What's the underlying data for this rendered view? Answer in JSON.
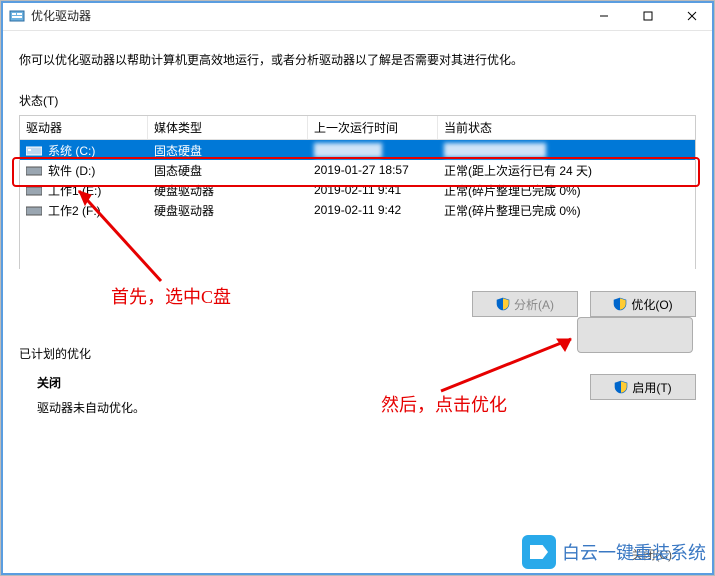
{
  "window": {
    "title": "优化驱动器"
  },
  "description": "你可以优化驱动器以帮助计算机更高效地运行，或者分析驱动器以了解是否需要对其进行优化。",
  "status_label": "状态(T)",
  "columns": {
    "drive": "驱动器",
    "media": "媒体类型",
    "last": "上一次运行时间",
    "current": "当前状态"
  },
  "rows": [
    {
      "name": "系统 (C:)",
      "media": "固态硬盘",
      "last": "",
      "status": "",
      "selected": true
    },
    {
      "name": "软件 (D:)",
      "media": "固态硬盘",
      "last": "2019-01-27 18:57",
      "status": "正常(距上次运行已有 24 天)"
    },
    {
      "name": "工作1 (E:)",
      "media": "硬盘驱动器",
      "last": "2019-02-11 9:41",
      "status": "正常(碎片整理已完成 0%)"
    },
    {
      "name": "工作2 (F:)",
      "media": "硬盘驱动器",
      "last": "2019-02-11 9:42",
      "status": "正常(碎片整理已完成 0%)"
    }
  ],
  "buttons": {
    "analyze": "分析(A)",
    "optimize": "优化(O)",
    "enable": "启用(T)",
    "close": "关闭(C)"
  },
  "scheduled": {
    "label": "已计划的优化",
    "state": "关闭",
    "detail": "驱动器未自动优化。"
  },
  "annotations": {
    "first": "首先，选中C盘",
    "then": "然后，点击优化"
  },
  "watermark": "白云一键重装系统"
}
